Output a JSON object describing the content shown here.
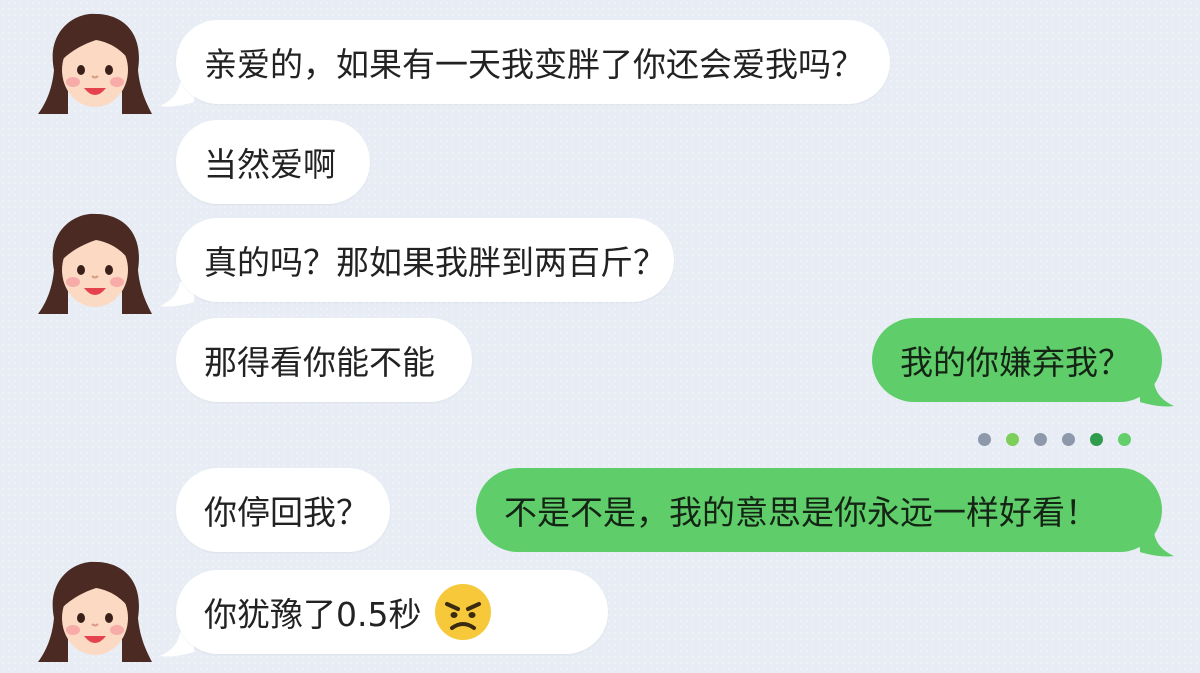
{
  "messages": [
    {
      "id": "m1",
      "side": "left",
      "avatar": true,
      "text": "亲爱的，如果有一天我变胖了你还会爱我吗？"
    },
    {
      "id": "m2",
      "side": "left",
      "avatar": false,
      "text": "当然爱啊"
    },
    {
      "id": "m3",
      "side": "left",
      "avatar": true,
      "text": "真的吗？那如果我胖到两百斤？"
    },
    {
      "id": "m4",
      "side": "left",
      "avatar": false,
      "text": "那得看你能不能"
    },
    {
      "id": "m5",
      "side": "right",
      "avatar": false,
      "text": "我的你嫌弃我？"
    },
    {
      "id": "m6",
      "side": "left",
      "avatar": false,
      "text": "你停回我？"
    },
    {
      "id": "m7",
      "side": "right",
      "avatar": false,
      "text": "不是不是，我的意思是你永远一样好看！"
    },
    {
      "id": "m8",
      "side": "left",
      "avatar": true,
      "text": "你犹豫了0.5秒",
      "emoji": "angry-face-icon"
    }
  ],
  "typing_dots": {
    "colors": [
      "#8d99ab",
      "#7ccf5a",
      "#8d99ab",
      "#8d99ab",
      "#2f9b4c",
      "#63cf6b"
    ]
  },
  "colors": {
    "background": "#e8edf5",
    "left_bubble": "#ffffff",
    "right_bubble": "#5fcd6a"
  }
}
